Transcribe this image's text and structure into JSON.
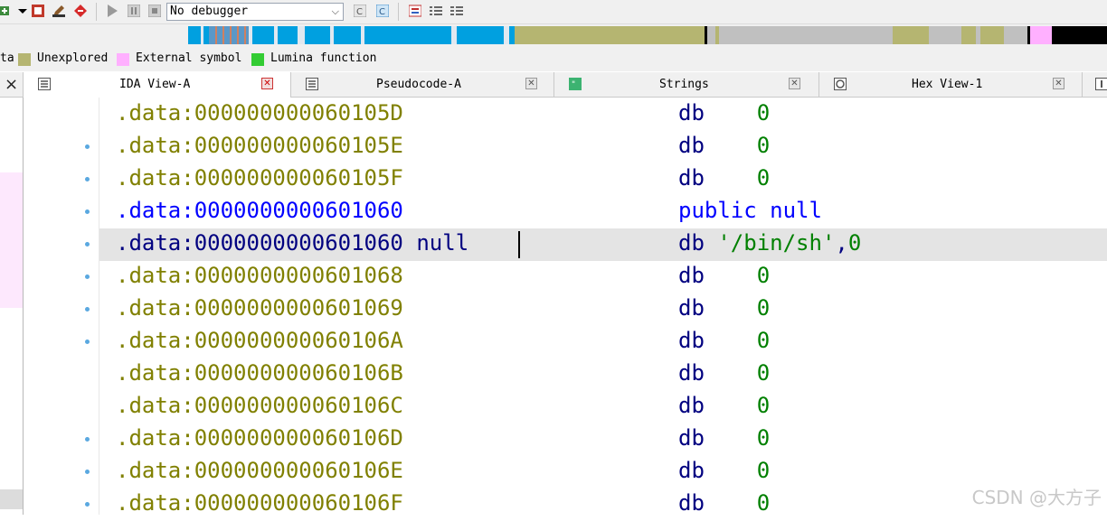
{
  "toolbar": {
    "debugger_select": "No debugger",
    "icons": [
      "plus-icon",
      "dropdown-arrow-icon",
      "stop-recording-icon",
      "edit-icon",
      "diamond-stop-icon",
      "play-icon",
      "pause-icon",
      "stop-icon",
      "breakpoint-c-icon",
      "breakpoint-c-active-icon",
      "list-icon",
      "indent-list-icon",
      "outdent-list-icon"
    ]
  },
  "navbar": {
    "colors": {
      "code": "#00a0e0",
      "code_alt": "#e09060",
      "unexplored": "#b5b571",
      "data": "#c0c0c0",
      "external": "#ffb0ff",
      "end": "#000000"
    }
  },
  "legend": [
    {
      "label": "ta",
      "color": "#c0c0c0"
    },
    {
      "label": "Unexplored",
      "color": "#b5b571"
    },
    {
      "label": "External symbol",
      "color": "#ffb0ff"
    },
    {
      "label": "Lumina function",
      "color": "#33cc33"
    }
  ],
  "tabs": [
    {
      "label": "IDA View-A",
      "icon": "ida-view-icon",
      "active": true
    },
    {
      "label": "Pseudocode-A",
      "icon": "pseudocode-icon",
      "active": false
    },
    {
      "label": "Strings",
      "icon": "strings-icon",
      "active": false
    },
    {
      "label": "Hex View-1",
      "icon": "hex-view-icon",
      "active": false
    }
  ],
  "left_close": "×",
  "listing": [
    {
      "addr": ".data:000000000060105D",
      "name": "",
      "mnem": "db",
      "operand": "0",
      "dot": false,
      "kind": "normal"
    },
    {
      "addr": ".data:000000000060105E",
      "name": "",
      "mnem": "db",
      "operand": "0",
      "dot": true,
      "kind": "normal"
    },
    {
      "addr": ".data:000000000060105F",
      "name": "",
      "mnem": "db",
      "operand": "0",
      "dot": true,
      "kind": "normal"
    },
    {
      "addr": ".data:0000000000601060",
      "name": "",
      "mnem": "public null",
      "operand": "",
      "dot": true,
      "kind": "public"
    },
    {
      "addr": ".data:0000000000601060",
      "name": "null",
      "mnem": "db",
      "operand": "'/bin/sh',0",
      "dot": true,
      "kind": "current"
    },
    {
      "addr": ".data:0000000000601068",
      "name": "",
      "mnem": "db",
      "operand": "0",
      "dot": true,
      "kind": "normal"
    },
    {
      "addr": ".data:0000000000601069",
      "name": "",
      "mnem": "db",
      "operand": "0",
      "dot": true,
      "kind": "normal"
    },
    {
      "addr": ".data:000000000060106A",
      "name": "",
      "mnem": "db",
      "operand": "0",
      "dot": true,
      "kind": "normal"
    },
    {
      "addr": ".data:000000000060106B",
      "name": "",
      "mnem": "db",
      "operand": "0",
      "dot": false,
      "kind": "normal"
    },
    {
      "addr": ".data:000000000060106C",
      "name": "",
      "mnem": "db",
      "operand": "0",
      "dot": false,
      "kind": "normal"
    },
    {
      "addr": ".data:000000000060106D",
      "name": "",
      "mnem": "db",
      "operand": "0",
      "dot": true,
      "kind": "normal"
    },
    {
      "addr": ".data:000000000060106E",
      "name": "",
      "mnem": "db",
      "operand": "0",
      "dot": true,
      "kind": "normal"
    },
    {
      "addr": ".data:000000000060106F",
      "name": "",
      "mnem": "db",
      "operand": "0",
      "dot": true,
      "kind": "normal"
    }
  ],
  "watermark": "CSDN @大方子"
}
